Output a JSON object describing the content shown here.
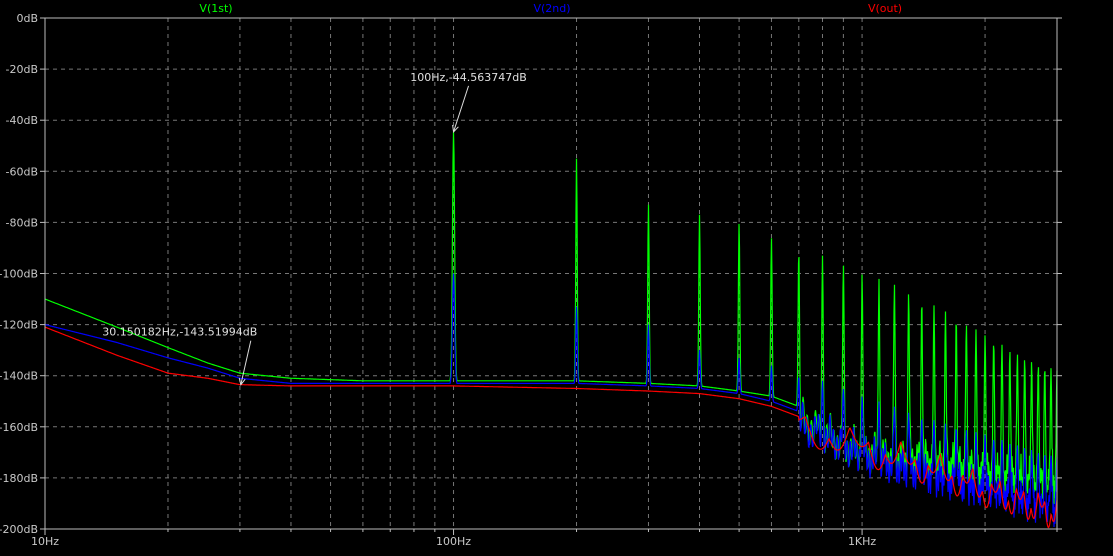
{
  "chart_data": {
    "type": "line",
    "x_scale": "log",
    "xlim_hz": [
      10,
      3000
    ],
    "ylim_db": [
      -200,
      0
    ],
    "grid": true,
    "x_ticks": [
      {
        "value": 10,
        "label": "10Hz"
      },
      {
        "value": 100,
        "label": "100Hz"
      },
      {
        "value": 1000,
        "label": "1KHz"
      }
    ],
    "y_ticks": [
      {
        "value": 0,
        "label": "0dB"
      },
      {
        "value": -20,
        "label": "-20dB"
      },
      {
        "value": -40,
        "label": "-40dB"
      },
      {
        "value": -60,
        "label": "-60dB"
      },
      {
        "value": -80,
        "label": "-80dB"
      },
      {
        "value": -100,
        "label": "-100dB"
      },
      {
        "value": -120,
        "label": "-120dB"
      },
      {
        "value": -140,
        "label": "-140dB"
      },
      {
        "value": -160,
        "label": "-160dB"
      },
      {
        "value": -180,
        "label": "-180dB"
      },
      {
        "value": -200,
        "label": "-200dB"
      }
    ],
    "legend_placement": "top",
    "series": [
      {
        "name": "V(1st)",
        "color": "#00ff00",
        "baseline": [
          [
            10,
            -110
          ],
          [
            15,
            -121
          ],
          [
            20,
            -129
          ],
          [
            25,
            -135
          ],
          [
            30,
            -139
          ],
          [
            40,
            -141
          ],
          [
            60,
            -142
          ],
          [
            100,
            -142
          ],
          [
            200,
            -142
          ],
          [
            300,
            -143
          ],
          [
            400,
            -144
          ],
          [
            500,
            -146
          ],
          [
            600,
            -148
          ],
          [
            700,
            -152
          ],
          [
            800,
            -157
          ],
          [
            900,
            -162
          ],
          [
            1000,
            -165
          ],
          [
            1200,
            -167
          ],
          [
            1400,
            -168
          ],
          [
            1700,
            -170
          ],
          [
            2000,
            -172
          ],
          [
            2500,
            -175
          ],
          [
            3000,
            -178
          ]
        ],
        "harmonic_peaks": [
          [
            100,
            -44.6
          ],
          [
            200,
            -55
          ],
          [
            300,
            -73
          ],
          [
            400,
            -77
          ],
          [
            500,
            -80
          ],
          [
            600,
            -86
          ],
          [
            700,
            -91
          ],
          [
            800,
            -93
          ],
          [
            900,
            -96
          ],
          [
            1000,
            -100
          ],
          [
            1200,
            -104
          ],
          [
            1400,
            -110
          ],
          [
            1700,
            -117
          ],
          [
            2000,
            -124
          ],
          [
            2500,
            -133
          ],
          [
            3000,
            -138
          ]
        ]
      },
      {
        "name": "V(2nd)",
        "color": "#0000ff",
        "baseline": [
          [
            10,
            -120
          ],
          [
            15,
            -127
          ],
          [
            20,
            -133
          ],
          [
            25,
            -137
          ],
          [
            30,
            -141
          ],
          [
            40,
            -143
          ],
          [
            60,
            -143
          ],
          [
            100,
            -143
          ],
          [
            200,
            -143
          ],
          [
            300,
            -144
          ],
          [
            400,
            -145
          ],
          [
            500,
            -147
          ],
          [
            600,
            -150
          ],
          [
            700,
            -154
          ],
          [
            800,
            -158
          ],
          [
            900,
            -162
          ],
          [
            1000,
            -166
          ],
          [
            1200,
            -170
          ],
          [
            1400,
            -173
          ],
          [
            1700,
            -177
          ],
          [
            2000,
            -180
          ],
          [
            2500,
            -184
          ],
          [
            3000,
            -188
          ]
        ],
        "harmonic_peaks": [
          [
            100,
            -100
          ],
          [
            200,
            -113
          ],
          [
            300,
            -120
          ],
          [
            400,
            -130
          ],
          [
            500,
            -133
          ],
          [
            600,
            -136
          ],
          [
            700,
            -140
          ],
          [
            800,
            -142
          ],
          [
            900,
            -145
          ],
          [
            1000,
            -148
          ],
          [
            1200,
            -152
          ],
          [
            1400,
            -156
          ],
          [
            1700,
            -160
          ],
          [
            2000,
            -163
          ],
          [
            2500,
            -168
          ],
          [
            3000,
            -172
          ]
        ]
      },
      {
        "name": "V(out)",
        "color": "#ff0000",
        "baseline": [
          [
            10,
            -121
          ],
          [
            15,
            -132
          ],
          [
            20,
            -139
          ],
          [
            25,
            -141
          ],
          [
            30,
            -143.5
          ],
          [
            40,
            -144
          ],
          [
            60,
            -144
          ],
          [
            100,
            -144
          ],
          [
            200,
            -145
          ],
          [
            300,
            -146
          ],
          [
            400,
            -147
          ],
          [
            500,
            -149
          ],
          [
            600,
            -152
          ],
          [
            700,
            -156
          ],
          [
            800,
            -160
          ],
          [
            900,
            -163
          ],
          [
            1000,
            -165
          ],
          [
            1200,
            -169
          ],
          [
            1400,
            -172
          ],
          [
            1700,
            -177
          ],
          [
            2000,
            -182
          ],
          [
            2500,
            -187
          ],
          [
            3000,
            -191
          ]
        ],
        "harmonic_peaks": []
      }
    ],
    "annotations": [
      {
        "text": "100Hz,-44.563747dB",
        "x": 100,
        "y": -44.563747,
        "label_side": "above"
      },
      {
        "text": "30.150182Hz,-143.51994dB",
        "x": 30.150182,
        "y": -143.51994,
        "label_side": "above-left"
      }
    ]
  }
}
